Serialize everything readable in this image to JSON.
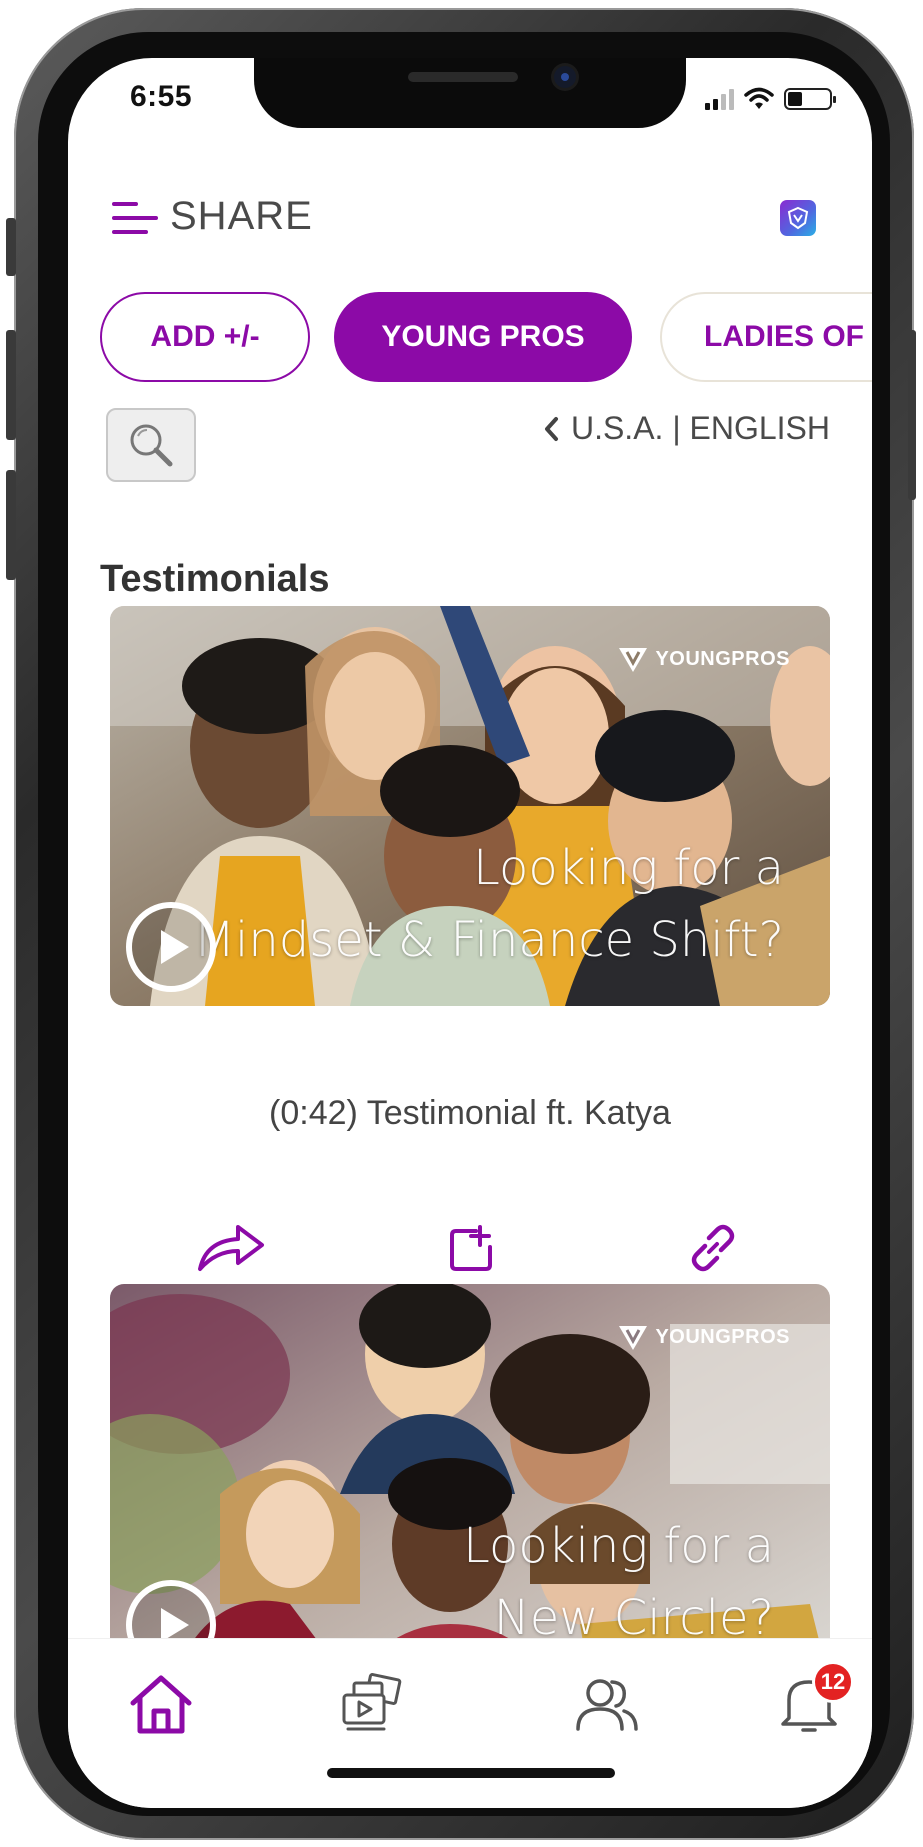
{
  "status_bar": {
    "time": "6:55"
  },
  "header": {
    "title": "SHARE",
    "menu_icon": "hamburger-menu-icon",
    "logo_icon": "app-logo-icon"
  },
  "chips": [
    {
      "label": "ADD +/-",
      "state": "outline"
    },
    {
      "label": "YOUNG PROS",
      "state": "selected"
    },
    {
      "label": "LADIES OF",
      "state": "outline"
    }
  ],
  "search": {
    "icon": "search-icon"
  },
  "region": {
    "label": "U.S.A. | ENGLISH"
  },
  "section": {
    "title": "Testimonials"
  },
  "cards": [
    {
      "brand": "YOUNGPROS",
      "overlay_line1": "Looking for a",
      "overlay_line2": "Mindset & Finance Shift?",
      "caption": "(0:42) Testimonial ft. Katya"
    },
    {
      "brand": "YOUNGPROS",
      "overlay_line1": "Looking for a",
      "overlay_line2": "New Circle?"
    }
  ],
  "actions": [
    {
      "icon": "share-arrow-icon"
    },
    {
      "icon": "add-to-collection-icon"
    },
    {
      "icon": "copy-link-icon"
    }
  ],
  "bottom_nav": [
    {
      "icon": "home-icon",
      "active": true
    },
    {
      "icon": "media-library-icon",
      "active": false
    },
    {
      "icon": "contacts-icon",
      "active": false
    },
    {
      "icon": "notifications-bell-icon",
      "active": false,
      "badge": "12"
    }
  ],
  "colors": {
    "accent": "#8c0aa7",
    "badge": "#e32222",
    "text": "#4a4a4a"
  }
}
